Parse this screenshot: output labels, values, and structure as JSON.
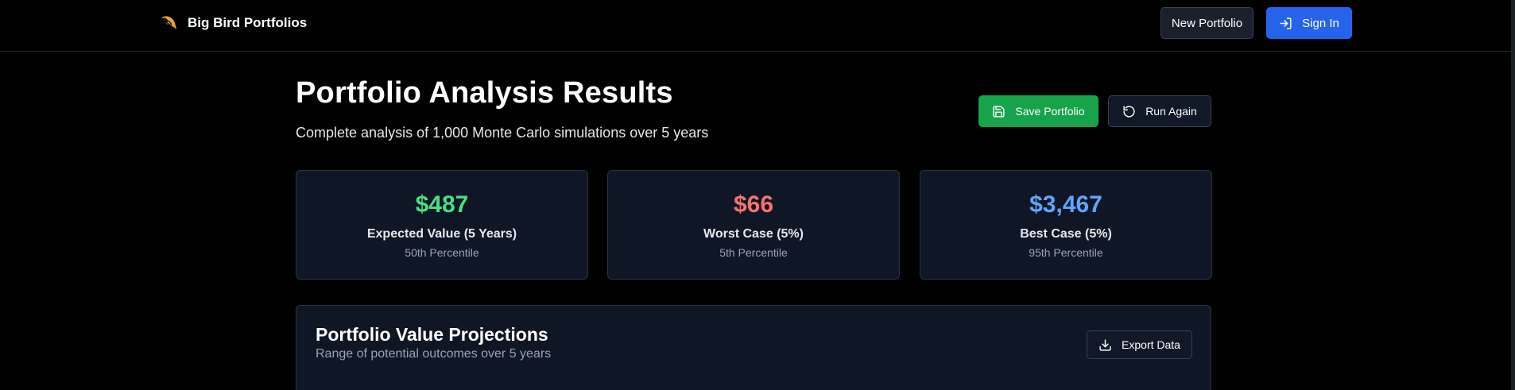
{
  "header": {
    "brand_name": "Big Bird Portfolios",
    "logo_icon": "bird-icon",
    "new_portfolio_label": "New Portfolio",
    "sign_in_label": "Sign In",
    "sign_in_icon": "sign-in-icon"
  },
  "main": {
    "title": "Portfolio Analysis Results",
    "subtitle": "Complete analysis of 1,000 Monte Carlo simulations over 5 years",
    "save_label": "Save Portfolio",
    "save_icon": "save-icon",
    "run_again_label": "Run Again",
    "run_again_icon": "refresh-icon"
  },
  "stats": [
    {
      "value": "$487",
      "label": "Expected Value (5 Years)",
      "sub": "50th Percentile",
      "color": "#4ade80"
    },
    {
      "value": "$66",
      "label": "Worst Case (5%)",
      "sub": "5th Percentile",
      "color": "#f87171"
    },
    {
      "value": "$3,467",
      "label": "Best Case (5%)",
      "sub": "95th Percentile",
      "color": "#60a5fa"
    }
  ],
  "projections": {
    "title": "Portfolio Value Projections",
    "subtitle": "Range of potential outcomes over 5 years",
    "export_label": "Export Data",
    "export_icon": "download-icon"
  },
  "colors": {
    "background": "#000000",
    "card_background": "#0f1726",
    "primary_blue": "#2563eb",
    "success_green": "#16a34a"
  }
}
